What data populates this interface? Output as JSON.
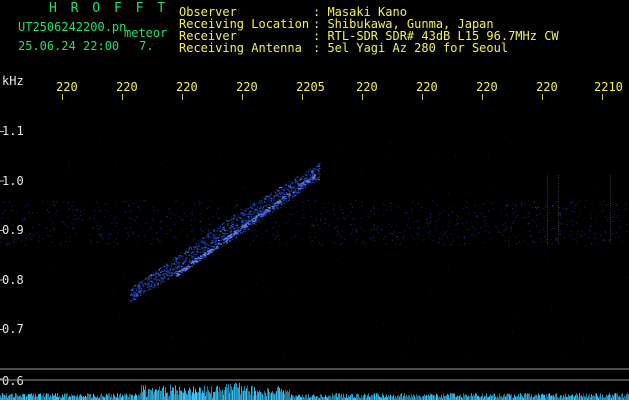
{
  "header": {
    "title_letters": "H R O F F T",
    "filename": "UT2506242200.pn",
    "tag": "meteor",
    "datetime": "25.06.24 22:00",
    "index": "7.",
    "fields": [
      {
        "label": "Observer",
        "value": ": Masaki Kano"
      },
      {
        "label": "Receiving Location",
        "value": ": Shibukawa, Gunma, Japan"
      },
      {
        "label": "Receiver",
        "value": ": RTL-SDR SDR# 43dB L15 96.7MHz CW"
      },
      {
        "label": "Receiving Antenna",
        "value": ": 5el Yagi Az 280 for Seoul"
      }
    ]
  },
  "axis": {
    "unit": "kHz",
    "y_ticks": [
      "1.1",
      "1.0",
      "0.9",
      "0.8",
      "0.7",
      "0.6"
    ],
    "time_ticks": [
      "220",
      "220",
      "220",
      "220",
      "2205",
      "220",
      "220",
      "220",
      "220",
      "2210"
    ]
  },
  "colors": {
    "background": "#000000",
    "header_green": "#22e06a",
    "header_yellow": "#f2f25a",
    "time_tick": "#f2f25a",
    "signal_blue": "#2e5cff",
    "noise_cyan": "#38c8ff"
  }
}
